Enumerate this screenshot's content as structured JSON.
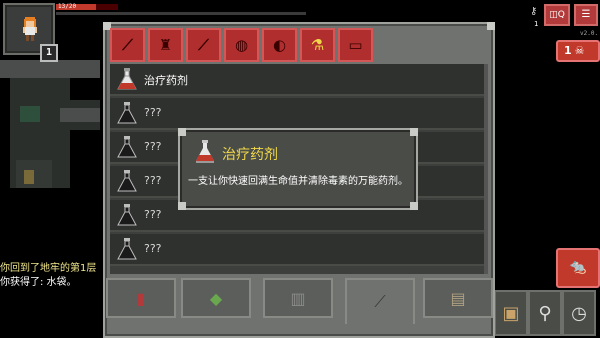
{
  "hero": {
    "hp_text": "13/20",
    "hp_fraction": 0.65,
    "depth": "1"
  },
  "top_right": {
    "key_count": "1",
    "journal_label": "◫Q",
    "menu_label": "☰",
    "version": "v2.0.",
    "danger_count": "1",
    "danger_icon": "skull-icon"
  },
  "inventory": {
    "tabs": [
      {
        "icon": "sword-icon",
        "glyph": "⟋"
      },
      {
        "icon": "armor-icon",
        "glyph": "♜"
      },
      {
        "icon": "wand-icon",
        "glyph": "⟋"
      },
      {
        "icon": "ring-icon",
        "glyph": "◍"
      },
      {
        "icon": "artifact-icon",
        "glyph": "◐"
      },
      {
        "icon": "potion-icon",
        "glyph": "⚗"
      },
      {
        "icon": "scroll-icon",
        "glyph": "▭"
      }
    ],
    "active_tab": 5,
    "items": [
      {
        "name": "治疗药剂",
        "known": true
      },
      {
        "name": "???",
        "known": false
      },
      {
        "name": "???",
        "known": false
      },
      {
        "name": "???",
        "known": false
      },
      {
        "name": "???",
        "known": false
      },
      {
        "name": "???",
        "known": false
      }
    ],
    "bottom_tabs": [
      {
        "icon": "spellbook-icon",
        "glyph": "▮"
      },
      {
        "icon": "pouch-icon",
        "glyph": "◆"
      },
      {
        "icon": "quiver-icon",
        "glyph": "▥"
      },
      {
        "icon": "sword-icon",
        "glyph": "⟋"
      },
      {
        "icon": "scroll-holder-icon",
        "glyph": "▤"
      }
    ]
  },
  "popup": {
    "title": "治疗药剂",
    "description": "一支让你快速回满生命值并清除毒素的万能药剂。"
  },
  "log": {
    "line1": "你回到了地牢的第1层",
    "line2": "你获得了: 水袋。"
  },
  "colors": {
    "accent_red": "#b12e2e",
    "highlight_yellow": "#f1d84a",
    "panel_gray": "#6f726e"
  }
}
